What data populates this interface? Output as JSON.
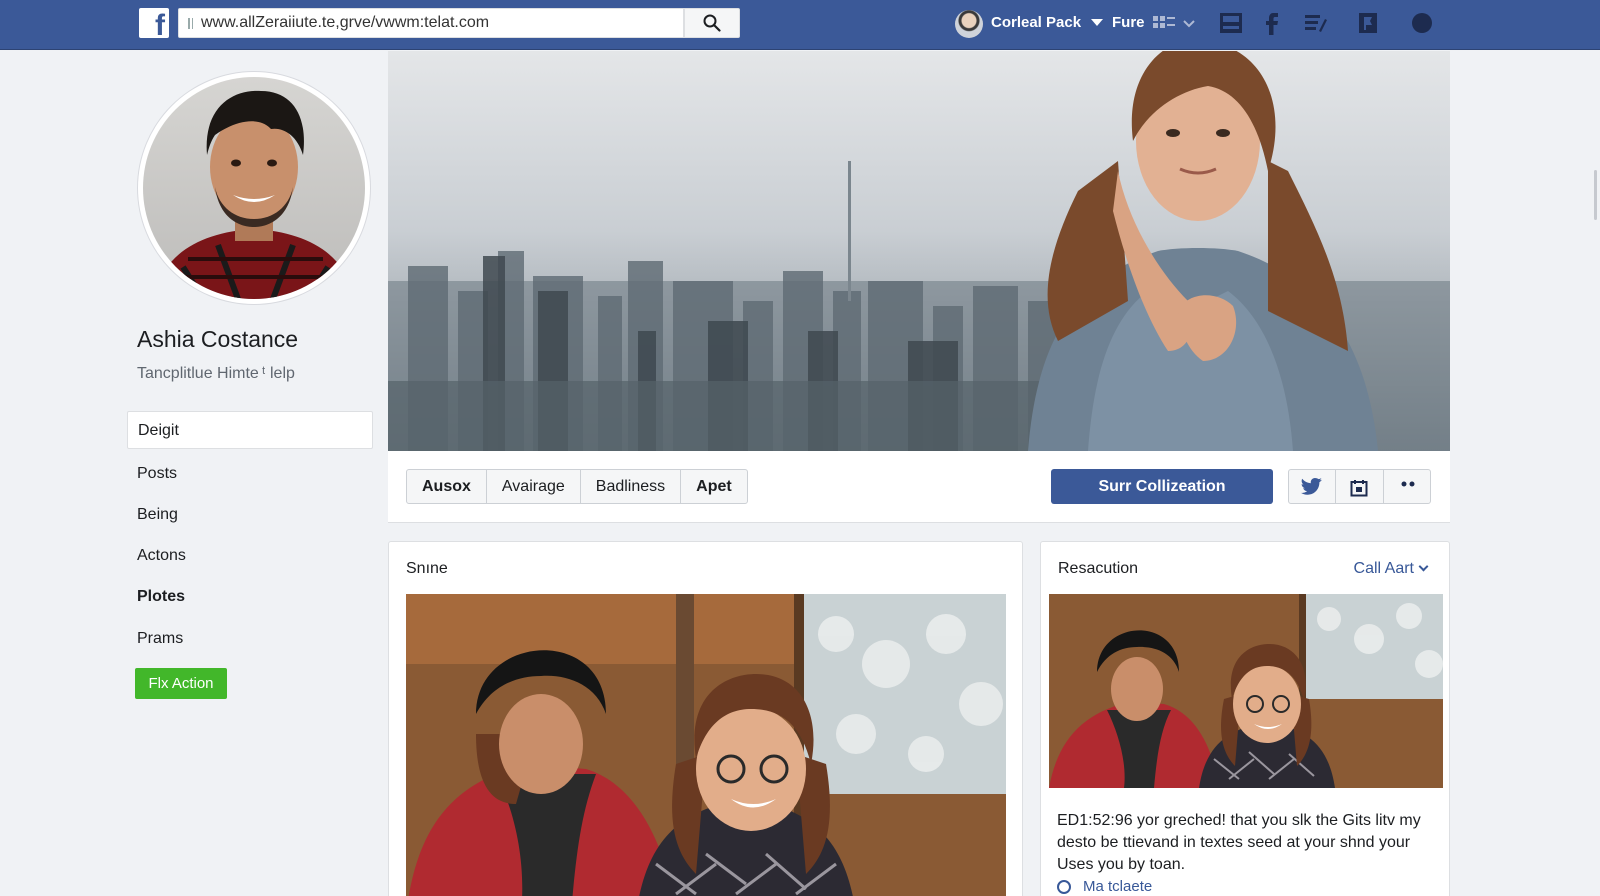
{
  "browser": {
    "url": "www.allZeraiiute.te,grve/vwwm:telat.com"
  },
  "topbar": {
    "user_name": "Corleal Pack",
    "link_label": "Fure",
    "icons": [
      "facebook-logo-icon",
      "search-icon",
      "grid-icon",
      "chevron-down-icon",
      "inbox-icon",
      "facebook-f-icon",
      "notes-icon",
      "flag-icon",
      "globe-icon"
    ]
  },
  "profile": {
    "name": "Ashia Costance",
    "subtitle": "Tancplitlue Himte ᵗ lelp"
  },
  "sidebar": {
    "selected": "Deigit",
    "items": [
      {
        "label": "Posts",
        "bold": false
      },
      {
        "label": "Being",
        "bold": false
      },
      {
        "label": "Actons",
        "bold": false
      },
      {
        "label": "Plotes",
        "bold": true
      },
      {
        "label": "Prams",
        "bold": false
      }
    ],
    "action_label": "Flx Action"
  },
  "tabs": [
    {
      "label": "Ausox",
      "bold": true
    },
    {
      "label": "Avairage",
      "bold": false
    },
    {
      "label": "Badliness",
      "bold": false
    },
    {
      "label": "Apet",
      "bold": true
    }
  ],
  "primary_button": "Surr Collizeation",
  "action_icons": [
    "twitter-icon",
    "calendar-icon",
    "more-icon"
  ],
  "main_card": {
    "title": "Snıne"
  },
  "side_card": {
    "title": "Resacution",
    "link": "Call Aart",
    "description": "ED1:52:96 yor greched! that you slk the Gits litv my desto be ttievand in textes seed at your shnd your Uses you by toan.",
    "more_link": "Ma tclaete"
  },
  "colors": {
    "brand": "#3b5998",
    "action_green": "#42b72a",
    "link": "#385898"
  }
}
